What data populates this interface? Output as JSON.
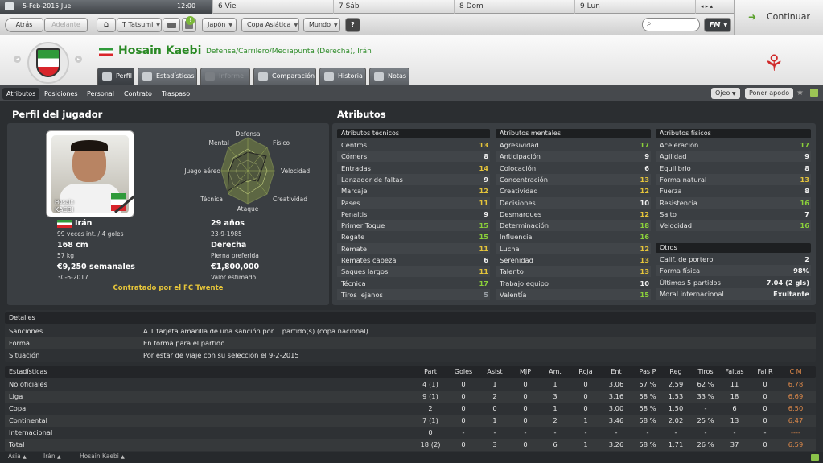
{
  "topbar": {
    "date": "5-Feb-2015 Jue",
    "time": "12:00",
    "days": [
      "6 Vie",
      "7 Sáb",
      "8 Dom",
      "9 Lun"
    ]
  },
  "toolbar": {
    "back": "Atrás",
    "forward": "Adelante",
    "manager": "T Tatsumi",
    "nation": "Japón",
    "competition": "Copa Asiática",
    "world": "Mundo",
    "help": "?",
    "search_placeholder": "",
    "fm": "FM",
    "notif_count": "!"
  },
  "continuar": "Continuar",
  "header": {
    "name": "Hosain Kaebi",
    "positions": "Defensa/Carrilero/Mediapunta (Derecha), Irán"
  },
  "tabs": [
    "Perfil",
    "Estadísticas",
    "Informe",
    "Comparación",
    "Historia",
    "Notas"
  ],
  "subnav": {
    "items": [
      "Atributos",
      "Posiciones",
      "Personal",
      "Contrato",
      "Traspaso"
    ],
    "ojeo": "Ojeo",
    "apodo": "Poner apodo"
  },
  "profile": {
    "title": "Perfil del jugador",
    "card_first": "Hosain",
    "card_last": "KAEBI",
    "nation": "Irán",
    "caps": "99 veces int. / 4 goles",
    "age": "29 años",
    "dob": "23-9-1985",
    "height": "168 cm",
    "weight": "57 kg",
    "foot": "Derecha",
    "foot_label": "Pierna preferida",
    "wage": "€9,250 semanales",
    "contract_end": "30-6-2017",
    "value": "€1,800,000",
    "value_label": "Valor estimado",
    "status": "Contratado por el FC Twente"
  },
  "radar": {
    "labels": [
      "Defensa",
      "Físico",
      "Velocidad",
      "Creatividad",
      "Ataque",
      "Técnica",
      "Juego aéreo",
      "Mental"
    ]
  },
  "attributes": {
    "title": "Atributos",
    "technical_title": "Atributos técnicos",
    "technical": [
      [
        "Centros",
        "13"
      ],
      [
        "Córners",
        "8"
      ],
      [
        "Entradas",
        "14"
      ],
      [
        "Lanzador de faltas",
        "9"
      ],
      [
        "Marcaje",
        "12"
      ],
      [
        "Pases",
        "11"
      ],
      [
        "Penaltis",
        "9"
      ],
      [
        "Primer Toque",
        "15"
      ],
      [
        "Regate",
        "15"
      ],
      [
        "Remate",
        "11"
      ],
      [
        "Remates cabeza",
        "6"
      ],
      [
        "Saques largos",
        "11"
      ],
      [
        "Técnica",
        "17"
      ],
      [
        "Tiros lejanos",
        "5"
      ]
    ],
    "mental_title": "Atributos mentales",
    "mental": [
      [
        "Agresividad",
        "17"
      ],
      [
        "Anticipación",
        "9"
      ],
      [
        "Colocación",
        "6"
      ],
      [
        "Concentración",
        "13"
      ],
      [
        "Creatividad",
        "12"
      ],
      [
        "Decisiones",
        "10"
      ],
      [
        "Desmarques",
        "12"
      ],
      [
        "Determinación",
        "18"
      ],
      [
        "Influencia",
        "16"
      ],
      [
        "Lucha",
        "12"
      ],
      [
        "Serenidad",
        "13"
      ],
      [
        "Talento",
        "13"
      ],
      [
        "Trabajo equipo",
        "10"
      ],
      [
        "Valentía",
        "15"
      ]
    ],
    "physical_title": "Atributos físicos",
    "physical": [
      [
        "Aceleración",
        "17"
      ],
      [
        "Agilidad",
        "9"
      ],
      [
        "Equilibrio",
        "8"
      ],
      [
        "Forma natural",
        "13"
      ],
      [
        "Fuerza",
        "8"
      ],
      [
        "Resistencia",
        "16"
      ],
      [
        "Salto",
        "7"
      ],
      [
        "Velocidad",
        "16"
      ]
    ],
    "others_title": "Otros",
    "others": [
      [
        "Calif. de portero",
        "2"
      ],
      [
        "Forma física",
        "98%"
      ],
      [
        "Últimos 5 partidos",
        "7.04 (2 gls)"
      ],
      [
        "Moral internacional",
        "Exultante"
      ]
    ]
  },
  "details": {
    "title": "Detalles",
    "rows": [
      [
        "Sanciones",
        "A 1 tarjeta amarilla de una sanción por 1 partido(s) (copa nacional)"
      ],
      [
        "Forma",
        "En forma para el partido"
      ],
      [
        "Situación",
        "Por estar de viaje con su selección el 9-2-2015"
      ]
    ]
  },
  "stats": {
    "title": "Estadísticas",
    "columns": [
      "Part",
      "Goles",
      "Asist",
      "MJP",
      "Am.",
      "Roja",
      "Ent",
      "Pas P",
      "Reg",
      "Tiros",
      "Faltas",
      "Fal R",
      "C M"
    ],
    "rows": [
      [
        "No oficiales",
        "4 (1)",
        "0",
        "1",
        "0",
        "1",
        "0",
        "3.06",
        "57 %",
        "2.59",
        "62 %",
        "11",
        "0",
        "6.78"
      ],
      [
        "Liga",
        "9 (1)",
        "0",
        "2",
        "0",
        "3",
        "0",
        "3.16",
        "58 %",
        "1.53",
        "33 %",
        "18",
        "0",
        "6.69"
      ],
      [
        "Copa",
        "2",
        "0",
        "0",
        "0",
        "1",
        "0",
        "3.00",
        "58 %",
        "1.50",
        "-",
        "6",
        "0",
        "6.50"
      ],
      [
        "Continental",
        "7 (1)",
        "0",
        "1",
        "0",
        "2",
        "1",
        "3.46",
        "58 %",
        "2.02",
        "25 %",
        "13",
        "0",
        "6.47"
      ],
      [
        "Internacional",
        "0",
        "-",
        "-",
        "-",
        "-",
        "-",
        "-",
        "-",
        "-",
        "-",
        "-",
        "-",
        "----"
      ],
      [
        "Total",
        "18 (2)",
        "0",
        "3",
        "0",
        "6",
        "1",
        "3.26",
        "58 %",
        "1.71",
        "26 %",
        "37",
        "0",
        "6.59"
      ]
    ]
  },
  "footer": [
    "Asia",
    "Irán",
    "Hosain Kaebi"
  ]
}
